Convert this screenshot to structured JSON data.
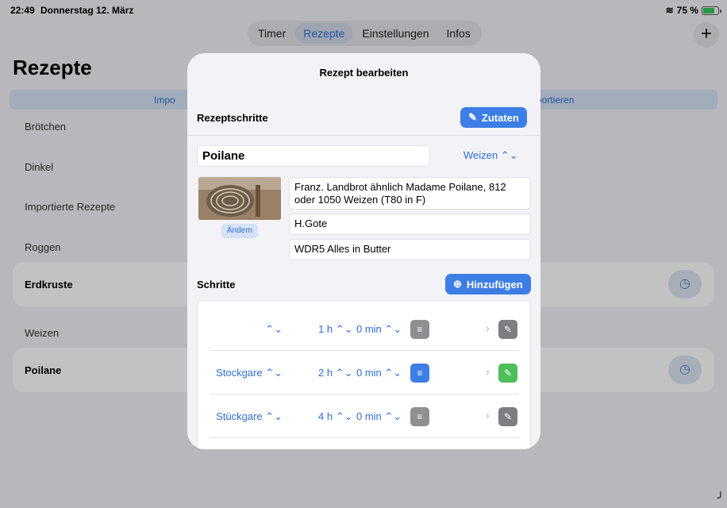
{
  "status": {
    "time": "22:49",
    "date": "Donnerstag 12. März",
    "wifi_icon": "wifi-icon",
    "battery": "75 %",
    "battery_level": 0.75
  },
  "tabs": [
    {
      "label": "Timer"
    },
    {
      "label": "Rezepte",
      "active": true
    },
    {
      "label": "Einstellungen"
    },
    {
      "label": "Infos"
    }
  ],
  "add_label": "+",
  "page_title": "Rezepte",
  "import_bar": {
    "left": "Impo",
    "right": "portieren"
  },
  "list": {
    "brotchen": "Brötchen",
    "dinkel": "Dinkel",
    "importierte": "Importierte Rezepte",
    "roggen": "Roggen",
    "erdkruste": "Erdkruste",
    "weizen": "Weizen",
    "poilane": "Poilane"
  },
  "modal": {
    "title": "Rezept bearbeiten",
    "rezeptschritte": "Rezeptschritte",
    "zutaten_button": "Zutaten",
    "name": "Poilane",
    "category": "Weizen ⌃⌄",
    "aendern": "Ändern",
    "description": "Franz. Landbrot ähnlich Madame Poilane, 812 oder 1050 Weizen (T80 in F)",
    "author": "H.Gote",
    "source": "WDR5 Alles in Butter",
    "schritte": "Schritte",
    "add_button": "Hinzufügen",
    "steps": [
      {
        "name": "⌃⌄",
        "hours": "1 h ⌃⌄",
        "minutes": "0 min ⌃⌄",
        "has_note": false,
        "edited": false
      },
      {
        "name": "Stockgare ⌃⌄",
        "hours": "2 h ⌃⌄",
        "minutes": "0 min ⌃⌄",
        "has_note": true,
        "edited": true
      },
      {
        "name": "Stückgare ⌃⌄",
        "hours": "4 h ⌃⌄",
        "minutes": "0 min ⌃⌄",
        "has_note": false,
        "edited": false
      }
    ]
  }
}
